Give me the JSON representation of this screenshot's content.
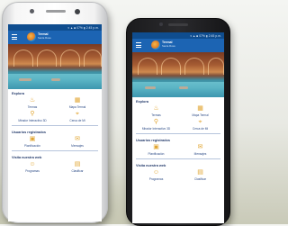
{
  "app": {
    "status": "▾ ▲ ■ 07% ▮ 2:45 p.m.",
    "brand_title": "Termal",
    "brand_sub": "Santa Rosa"
  },
  "sections": [
    {
      "title": "Explora",
      "items": [
        {
          "label": "Termas",
          "icon": "thermometer-icon"
        },
        {
          "label": "Mapa Termal",
          "icon": "map-icon"
        },
        {
          "label": "Mirador Interactivo 3D",
          "icon": "binoculars-icon"
        },
        {
          "label": "Cerca de Mi",
          "icon": "location-icon"
        }
      ]
    },
    {
      "title": "Usuarios registrados",
      "items": [
        {
          "label": "Planificación",
          "icon": "calendar-icon"
        },
        {
          "label": "Mensajes",
          "icon": "mail-icon"
        }
      ]
    },
    {
      "title": "Visita nuestra web",
      "items": [
        {
          "label": "Programas",
          "icon": "chat-icon"
        },
        {
          "label": "Clasificar",
          "icon": "grid-icon"
        }
      ]
    }
  ],
  "colors": {
    "primary": "#1c64b3",
    "accent": "#e1a532",
    "text": "#2c4b86"
  }
}
